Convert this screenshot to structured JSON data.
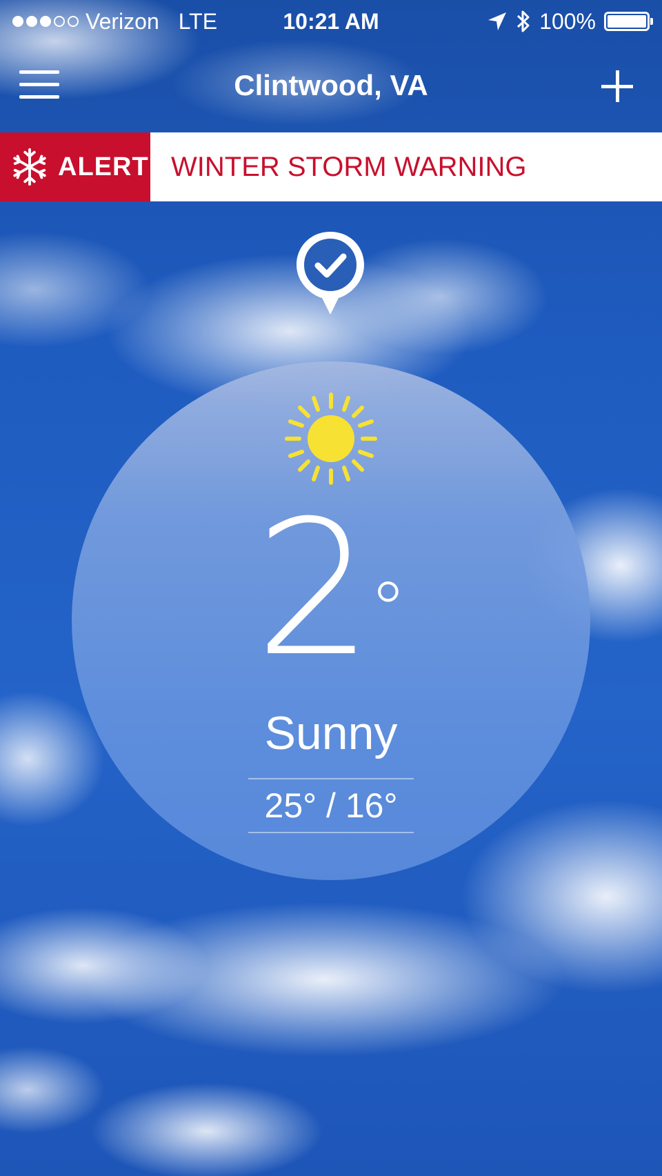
{
  "status_bar": {
    "signal_dots_filled": 3,
    "signal_dots_total": 5,
    "carrier": "Verizon",
    "network": "LTE",
    "time": "10:21 AM",
    "battery_percent": "100%",
    "battery_level": 1.0,
    "icons": [
      "location-arrow-icon",
      "bluetooth-icon",
      "battery-icon"
    ]
  },
  "nav": {
    "title": "Clintwood, VA",
    "menu_icon": "hamburger-menu-icon",
    "add_icon": "plus-icon"
  },
  "alert": {
    "tag_label": "ALERT",
    "tag_icon": "snowflake-icon",
    "message": "WINTER STORM WARNING",
    "color": "#c8102e"
  },
  "location_marker": {
    "icon": "check-pin-icon"
  },
  "current": {
    "icon": "sun-icon",
    "temperature": "2",
    "degree_symbol": "°",
    "condition": "Sunny",
    "high_low": "25° / 16°",
    "sun_color": "#f7e234"
  }
}
